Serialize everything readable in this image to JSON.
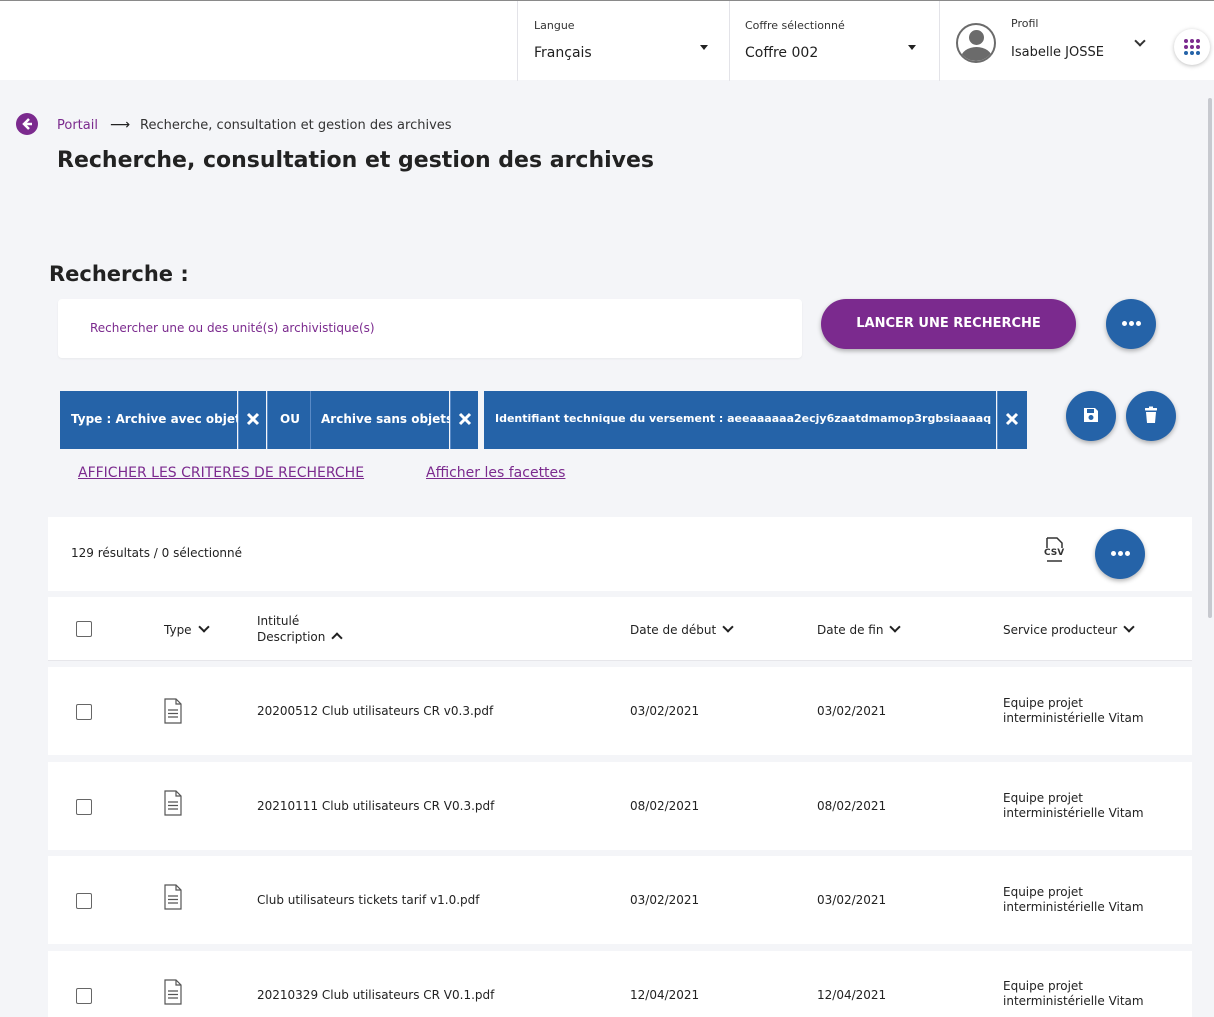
{
  "header": {
    "language_label": "Langue",
    "language_value": "Français",
    "vault_label": "Coffre sélectionné",
    "vault_value": "Coffre 002",
    "profile_label": "Profil",
    "profile_value": "Isabelle JOSSE"
  },
  "breadcrumb": {
    "root": "Portail",
    "arrow": "⟶",
    "current": "Recherche, consultation et gestion des archives"
  },
  "page_title": "Recherche, consultation et gestion des archives",
  "search": {
    "heading": "Recherche :",
    "placeholder": "Rechercher une ou des unité(s) archivistique(s)",
    "launch_label": "LANCER UNE RECHERCHE"
  },
  "criteria": {
    "type_label": "Type : Archive avec objets",
    "or_label": "OU",
    "type_alt_label": "Archive sans objets",
    "identifier_label": "Identifiant technique du versement : aeeaaaaaa2ecjy6zaatdmamop3rgbsiaaaaq"
  },
  "links": {
    "show_criteria": "AFFICHER LES CRITERES DE RECHERCHE",
    "show_facets": "Afficher les facettes"
  },
  "results": {
    "count_text": "129 résultats / 0 sélectionné",
    "csv_label": "CSV"
  },
  "table": {
    "headers": {
      "type": "Type",
      "title_line1": "Intitulé",
      "title_line2": "Description",
      "start_date": "Date de début",
      "end_date": "Date de fin",
      "producer": "Service producteur"
    },
    "rows": [
      {
        "title": "20200512 Club utilisateurs CR v0.3.pdf",
        "start": "03/02/2021",
        "end": "03/02/2021",
        "producer_line1": "Equipe projet",
        "producer_line2": "interministérielle Vitam"
      },
      {
        "title": "20210111 Club utilisateurs CR V0.3.pdf",
        "start": "08/02/2021",
        "end": "08/02/2021",
        "producer_line1": "Equipe projet",
        "producer_line2": "interministérielle Vitam"
      },
      {
        "title": "Club utilisateurs tickets tarif v1.0.pdf",
        "start": "03/02/2021",
        "end": "03/02/2021",
        "producer_line1": "Equipe projet",
        "producer_line2": "interministérielle Vitam"
      },
      {
        "title": "20210329 Club utilisateurs CR V0.1.pdf",
        "start": "12/04/2021",
        "end": "12/04/2021",
        "producer_line1": "Equipe projet",
        "producer_line2": "interministérielle Vitam"
      }
    ]
  },
  "colors": {
    "primary_purple": "#7b2a8e",
    "primary_blue": "#2563a8",
    "background": "#f4f5f8"
  },
  "icons": [
    "back-arrow-icon",
    "apps-grid-icon",
    "more-icon",
    "save-icon",
    "trash-icon",
    "close-icon",
    "csv-export-icon",
    "document-icon",
    "chevron-down-icon",
    "chevron-up-icon",
    "user-avatar-icon"
  ]
}
